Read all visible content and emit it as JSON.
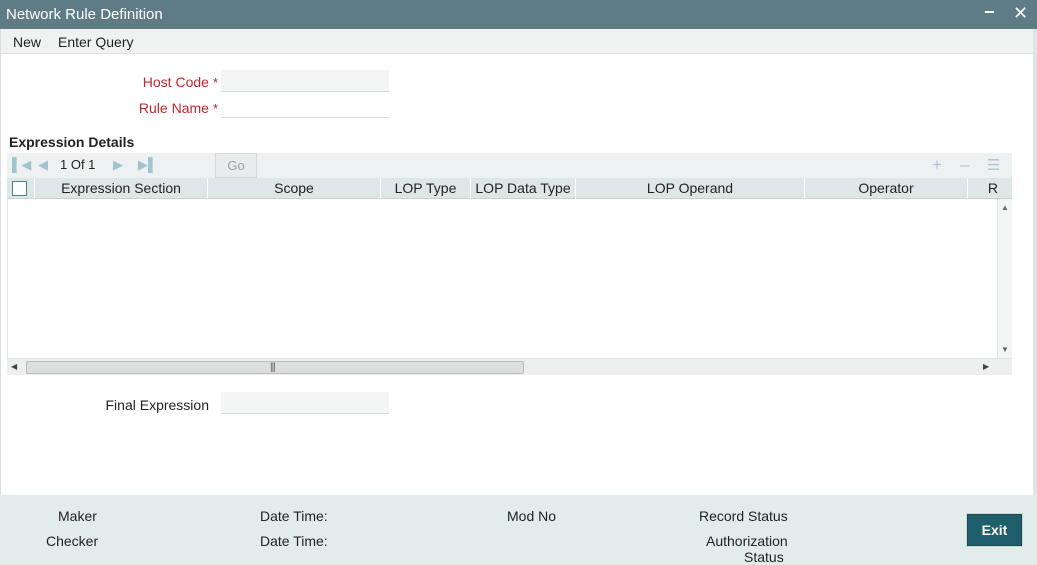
{
  "window": {
    "title": "Network Rule Definition",
    "minimize_glyph": "−",
    "close_glyph": "✕"
  },
  "menu": {
    "new_label": "New",
    "enter_query_label": "Enter Query"
  },
  "form": {
    "host_code_label": "Host Code",
    "host_code_value": "",
    "rule_name_label": "Rule Name",
    "rule_name_value": "",
    "required_marker": "*",
    "final_expression_label": "Final Expression",
    "final_expression_value": ""
  },
  "expression_details": {
    "section_title": "Expression Details",
    "pager": "1 Of 1",
    "go_label": "Go",
    "columns": [
      "Expression Section",
      "Scope",
      "LOP Type",
      "LOP Data Type",
      "LOP Operand",
      "Operator",
      "R"
    ],
    "rows": []
  },
  "footer": {
    "maker_label": "Maker",
    "checker_label": "Checker",
    "date_time_label_1": "Date Time:",
    "date_time_label_2": "Date Time:",
    "mod_no_label": "Mod No",
    "record_status_label": "Record Status",
    "authorization_label": "Authorization",
    "status_label": "Status",
    "exit_label": "Exit"
  },
  "icons": {
    "first": "first-page-icon",
    "prev": "previous-page-icon",
    "next": "next-page-icon",
    "last": "last-page-icon",
    "add": "add-row-icon",
    "delete": "delete-row-icon",
    "view": "single-view-icon"
  },
  "colors": {
    "titlebar": "#5f7c86",
    "required_label": "#c0282e",
    "exit_button": "#1f5f6b",
    "footer_bg": "#e2eceb",
    "toolbar_icon": "#a9c9d4"
  }
}
